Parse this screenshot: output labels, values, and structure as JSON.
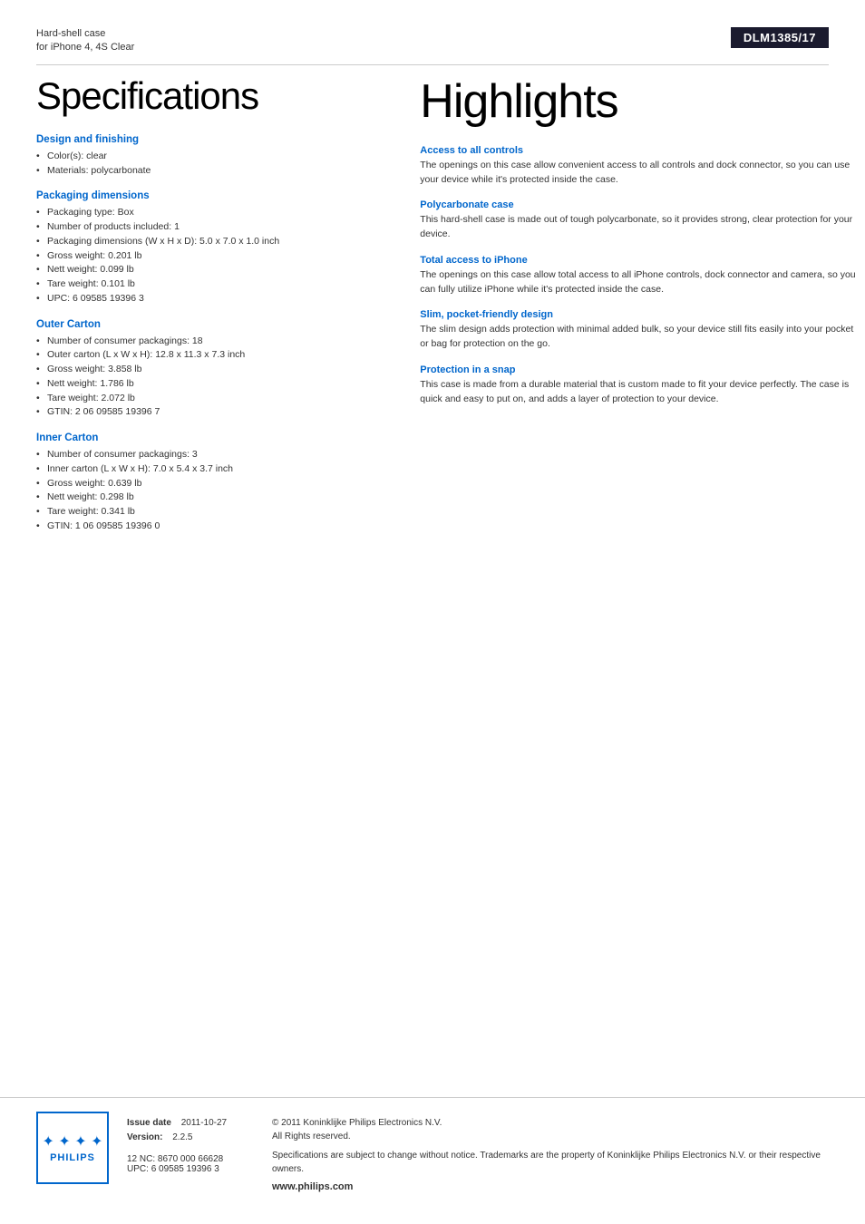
{
  "header": {
    "product_line": "Hard-shell case",
    "product_subtitle": "for iPhone 4, 4S Clear",
    "model": "DLM1385/17"
  },
  "left": {
    "page_title": "Specifications",
    "sections": [
      {
        "heading": "Design and finishing",
        "items": [
          "Color(s): clear",
          "Materials: polycarbonate"
        ]
      },
      {
        "heading": "Packaging dimensions",
        "items": [
          "Packaging type: Box",
          "Number of products included: 1",
          "Packaging dimensions (W x H x D): 5.0 x 7.0 x 1.0 inch",
          "Gross weight: 0.201 lb",
          "Nett weight: 0.099 lb",
          "Tare weight: 0.101 lb",
          "UPC: 6 09585 19396 3"
        ]
      },
      {
        "heading": "Outer Carton",
        "items": [
          "Number of consumer packagings: 18",
          "Outer carton (L x W x H): 12.8 x 11.3 x 7.3 inch",
          "Gross weight: 3.858 lb",
          "Nett weight: 1.786 lb",
          "Tare weight: 2.072 lb",
          "GTIN: 2 06 09585 19396 7"
        ]
      },
      {
        "heading": "Inner Carton",
        "items": [
          "Number of consumer packagings: 3",
          "Inner carton (L x W x H): 7.0 x 5.4 x 3.7 inch",
          "Gross weight: 0.639 lb",
          "Nett weight: 0.298 lb",
          "Tare weight: 0.341 lb",
          "GTIN: 1 06 09585 19396 0"
        ]
      }
    ]
  },
  "right": {
    "page_title": "Highlights",
    "highlights": [
      {
        "heading": "Access to all controls",
        "text": "The openings on this case allow convenient access to all controls and dock connector, so you can use your device while it's protected inside the case."
      },
      {
        "heading": "Polycarbonate case",
        "text": "This hard-shell case is made out of tough polycarbonate, so it provides strong, clear protection for your device."
      },
      {
        "heading": "Total access to iPhone",
        "text": "The openings on this case allow total access to all iPhone controls, dock connector and camera, so you can fully utilize iPhone while it's protected inside the case."
      },
      {
        "heading": "Slim, pocket-friendly design",
        "text": "The slim design adds protection with minimal added bulk, so your device still fits easily into your pocket or bag for protection on the go."
      },
      {
        "heading": "Protection in a snap",
        "text": "This case is made from a durable material that is custom made to fit your device perfectly. The case is quick and easy to put on, and adds a layer of protection to your device."
      }
    ]
  },
  "footer": {
    "issue_date_label": "Issue date",
    "issue_date": "2011-10-27",
    "version_label": "Version:",
    "version": "2.2.5",
    "nc_label": "12 NC:",
    "nc_value": "8670 000 66628",
    "upc_label": "UPC:",
    "upc_value": "6 09585 19396 3",
    "copyright": "© 2011 Koninklijke Philips Electronics N.V.",
    "rights": "All Rights reserved.",
    "disclaimer": "Specifications are subject to change without notice. Trademarks are the property of Koninklijke Philips Electronics N.V. or their respective owners.",
    "website": "www.philips.com",
    "logo_text": "PHILIPS"
  }
}
